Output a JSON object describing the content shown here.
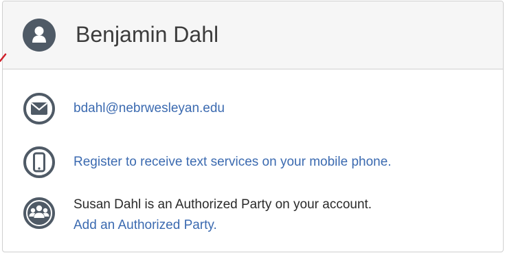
{
  "profile": {
    "name": "Benjamin Dahl",
    "avatar_icon": "user-avatar-icon"
  },
  "contact": {
    "email": "bdahl@nebrwesleyan.edu",
    "email_icon": "envelope-icon",
    "text_services_link": "Register to receive text services on your mobile phone.",
    "phone_icon": "mobile-phone-icon",
    "authorized_party_text": "Susan Dahl is an Authorized Party on your account.",
    "add_authorized_party_link": "Add an Authorized Party.",
    "group_icon": "group-users-icon"
  },
  "colors": {
    "link": "#3b6ab0",
    "icon": "#4f5a66",
    "header_bg": "#f6f6f6"
  }
}
